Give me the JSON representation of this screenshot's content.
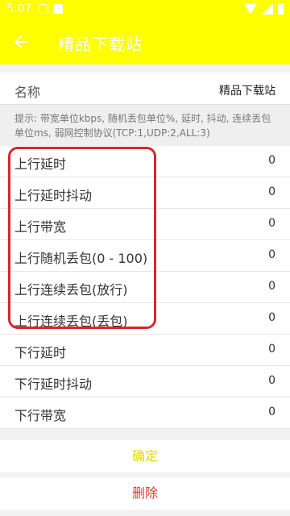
{
  "status_bar": {
    "time": "5:07"
  },
  "app_bar": {
    "title": "精品下载站"
  },
  "name_row": {
    "label": "名称",
    "value": "精品下载站"
  },
  "hint": "提示: 带宽单位kbps, 随机丢包单位%, 延时, 抖动, 连续丢包单位ms, 弱网控制协议(TCP:1,UDP:2,ALL:3)",
  "items": [
    {
      "label": "上行延时",
      "value": "0"
    },
    {
      "label": "上行延时抖动",
      "value": "0"
    },
    {
      "label": "上行带宽",
      "value": "0"
    },
    {
      "label": "上行随机丢包(0 - 100)",
      "value": "0"
    },
    {
      "label": "上行连续丢包(放行)",
      "value": "0"
    },
    {
      "label": "上行连续丢包(丢包)",
      "value": "0"
    },
    {
      "label": "下行延时",
      "value": "0"
    },
    {
      "label": "下行延时抖动",
      "value": "0"
    },
    {
      "label": "下行带宽",
      "value": "0"
    }
  ],
  "buttons": {
    "confirm": "确定",
    "delete": "删除"
  },
  "colors": {
    "accent": "#ffff00",
    "highlight": "#d8262e",
    "delete": "#e53935"
  }
}
